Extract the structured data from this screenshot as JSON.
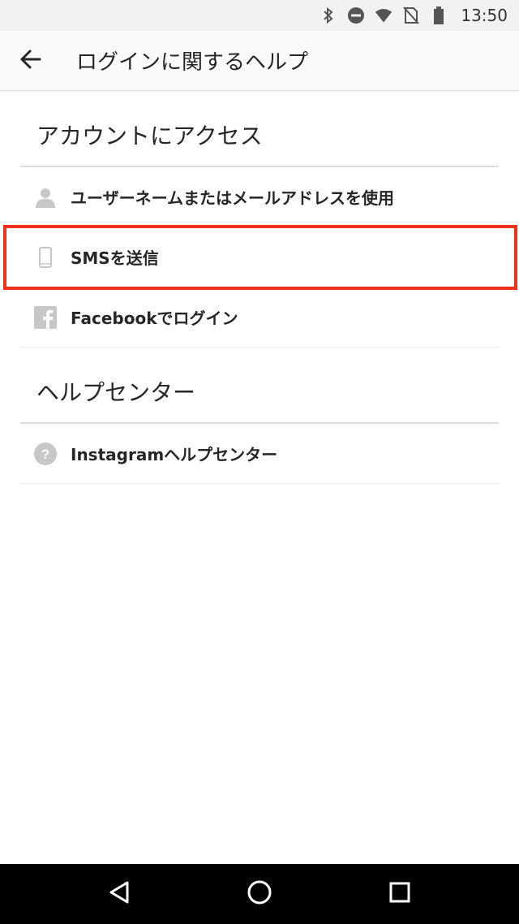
{
  "status_bar": {
    "time": "13:50",
    "icons": [
      "bluetooth-icon",
      "do-not-disturb-icon",
      "wifi-icon",
      "no-sim-icon",
      "battery-icon"
    ]
  },
  "app_bar": {
    "back_icon": "arrow-left-icon",
    "title": "ログインに関するヘルプ"
  },
  "sections": [
    {
      "header": "アカウントにアクセス",
      "items": [
        {
          "icon": "person-icon",
          "label": "ユーザーネームまたはメールアドレスを使用"
        },
        {
          "icon": "phone-icon",
          "label": "SMSを送信"
        },
        {
          "icon": "facebook-icon",
          "label": "Facebookでログイン"
        }
      ]
    },
    {
      "header": "ヘルプセンター",
      "items": [
        {
          "icon": "help-circle-icon",
          "label": "Instagramヘルプセンター"
        }
      ]
    }
  ],
  "highlight": {
    "target": "SMSを送信",
    "color": "#f0301d"
  },
  "nav_bar": {
    "buttons": [
      "back-triangle-icon",
      "home-circle-icon",
      "recents-square-icon"
    ]
  },
  "colors": {
    "accent_highlight": "#f0301d",
    "text_primary": "#262626",
    "icon_gray": "#c7c7c7",
    "divider": "#dbdbdb"
  }
}
